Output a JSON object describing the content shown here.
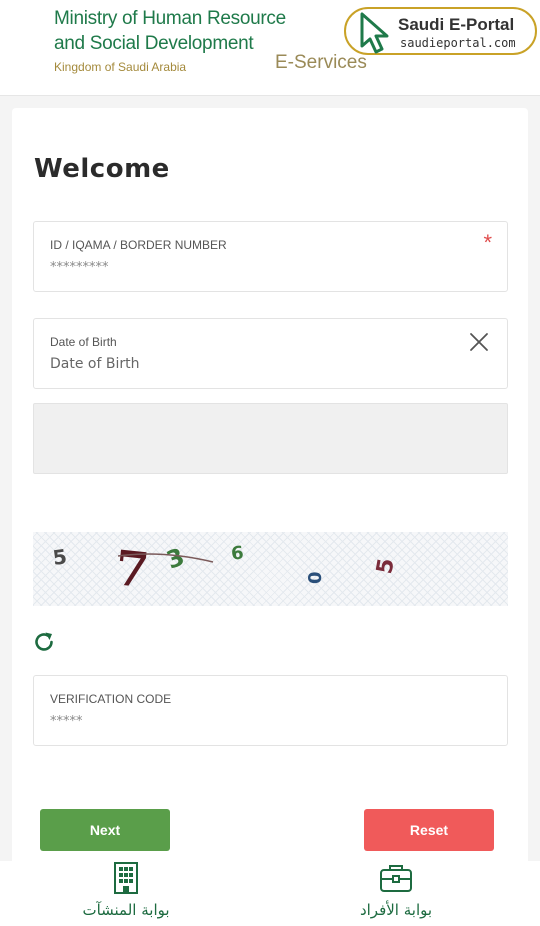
{
  "header": {
    "ministry_line1": "Ministry of Human Resource",
    "ministry_line2": "and Social Development",
    "ministry_line3": "Kingdom of Saudi Arabia",
    "eservices": "E-Services",
    "portal_title": "Saudi E-Portal",
    "portal_url": "saudieportal.com"
  },
  "form": {
    "title": "Welcome",
    "id_field": {
      "label": "ID / IQAMA / BORDER NUMBER",
      "placeholder": "*********",
      "required_mark": "*"
    },
    "dob_field": {
      "label": "Date of Birth",
      "placeholder": "Date of Birth"
    },
    "captcha": {
      "digits": [
        "5",
        "7",
        "3",
        "6",
        "0",
        "5"
      ]
    },
    "verification_field": {
      "label": "VERIFICATION CODE",
      "placeholder": "*****"
    },
    "next_label": "Next",
    "reset_label": "Reset"
  },
  "bottom_nav": {
    "establishments_label": "بوابة المنشآت",
    "individuals_label": "بوابة الأفراد"
  },
  "colors": {
    "brand_green": "#1f7a4a",
    "next_button": "#5a9e4a",
    "reset_button": "#f05a5a",
    "gold": "#c9a227"
  },
  "icons": [
    "cursor-icon",
    "close-icon",
    "refresh-icon",
    "building-icon",
    "briefcase-icon"
  ]
}
